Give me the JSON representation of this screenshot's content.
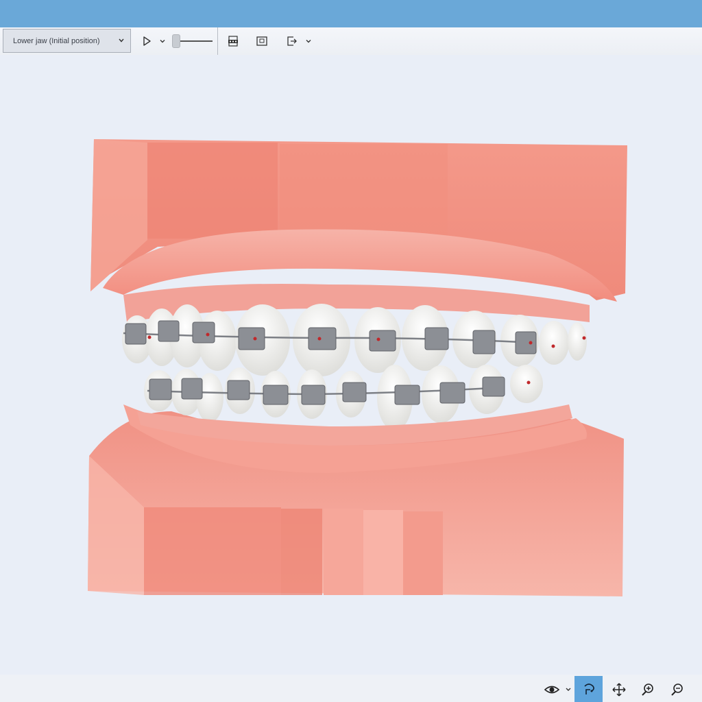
{
  "toolbar": {
    "jaw_select_value": "Lower jaw (Initial position)",
    "icons": [
      "chevron-down-icon",
      "play-icon",
      "pdf-export-icon",
      "screenshot-icon",
      "export-icon"
    ]
  },
  "bottom_toolbar": {
    "icons": [
      "eye-icon",
      "chevron-down-icon",
      "rotate-icon",
      "move-icon",
      "zoom-in-icon",
      "zoom-out-icon"
    ],
    "active_tool": "rotate-icon"
  },
  "colors": {
    "titlebar": "#6aa8d8",
    "active_tool_bg": "#5ea4dc",
    "gum": "#f08f80",
    "tooth": "#f7f7f5",
    "bracket": "#8a8d92"
  }
}
